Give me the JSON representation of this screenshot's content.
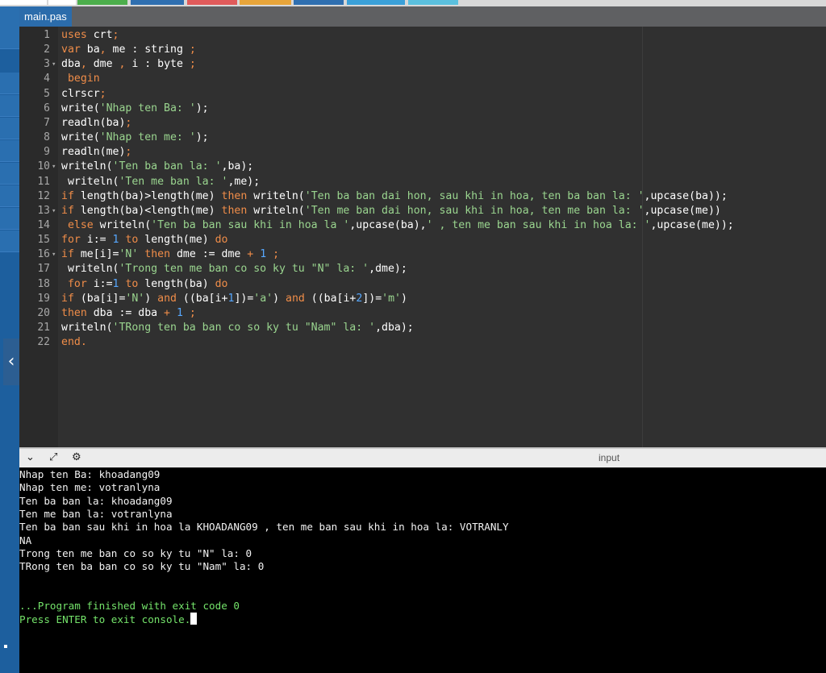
{
  "toolbar": {
    "colors": [
      "#ffffff",
      "#ffffff",
      "#4cae4c",
      "#2f6fb0",
      "#e05b5b",
      "#e8a53a",
      "#2f6fb0",
      "#3aa0d8",
      "#5bc0de"
    ]
  },
  "editor": {
    "tab_label": "main.pas",
    "lines": [
      {
        "n": "1",
        "fold": "",
        "tokens": [
          {
            "t": "uses",
            "c": "kw"
          },
          {
            "t": " crt",
            "c": ""
          },
          {
            "t": ";",
            "c": "kw"
          }
        ]
      },
      {
        "n": "2",
        "fold": "",
        "tokens": [
          {
            "t": "var",
            "c": "kw"
          },
          {
            "t": " ba",
            "c": ""
          },
          {
            "t": ",",
            "c": "kw"
          },
          {
            "t": " me : string ",
            "c": ""
          },
          {
            "t": ";",
            "c": "kw"
          }
        ]
      },
      {
        "n": "3",
        "fold": "▾",
        "tokens": [
          {
            "t": "dba",
            "c": ""
          },
          {
            "t": ",",
            "c": "kw"
          },
          {
            "t": " dme ",
            "c": ""
          },
          {
            "t": ",",
            "c": "kw"
          },
          {
            "t": " i : byte ",
            "c": ""
          },
          {
            "t": ";",
            "c": "kw"
          }
        ]
      },
      {
        "n": "4",
        "fold": "",
        "tokens": [
          {
            "t": " begin",
            "c": "kw"
          }
        ]
      },
      {
        "n": "5",
        "fold": "",
        "tokens": [
          {
            "t": "clrscr",
            "c": ""
          },
          {
            "t": ";",
            "c": "kw"
          }
        ]
      },
      {
        "n": "6",
        "fold": "",
        "tokens": [
          {
            "t": "write(",
            "c": ""
          },
          {
            "t": "'Nhap ten Ba: '",
            "c": "str"
          },
          {
            "t": ");",
            "c": ""
          }
        ]
      },
      {
        "n": "7",
        "fold": "",
        "tokens": [
          {
            "t": "readln(ba)",
            "c": ""
          },
          {
            "t": ";",
            "c": "kw"
          }
        ]
      },
      {
        "n": "8",
        "fold": "",
        "tokens": [
          {
            "t": "write(",
            "c": ""
          },
          {
            "t": "'Nhap ten me: '",
            "c": "str"
          },
          {
            "t": ");",
            "c": ""
          }
        ]
      },
      {
        "n": "9",
        "fold": "",
        "tokens": [
          {
            "t": "readln(me)",
            "c": ""
          },
          {
            "t": ";",
            "c": "kw"
          }
        ]
      },
      {
        "n": "10",
        "fold": "▾",
        "tokens": [
          {
            "t": "writeln(",
            "c": ""
          },
          {
            "t": "'Ten ba ban la: '",
            "c": "str"
          },
          {
            "t": ",ba);",
            "c": ""
          }
        ]
      },
      {
        "n": "11",
        "fold": "",
        "tokens": [
          {
            "t": " writeln(",
            "c": ""
          },
          {
            "t": "'Ten me ban la: '",
            "c": "str"
          },
          {
            "t": ",me);",
            "c": ""
          }
        ]
      },
      {
        "n": "12",
        "fold": "",
        "tokens": [
          {
            "t": "if",
            "c": "kw"
          },
          {
            "t": " length(ba)>length(me) ",
            "c": ""
          },
          {
            "t": "then",
            "c": "kw"
          },
          {
            "t": " writeln(",
            "c": ""
          },
          {
            "t": "'Ten ba ban dai hon, sau khi in hoa, ten ba ban la: '",
            "c": "str"
          },
          {
            "t": ",upcase(ba));",
            "c": ""
          }
        ]
      },
      {
        "n": "13",
        "fold": "▾",
        "tokens": [
          {
            "t": "if",
            "c": "kw"
          },
          {
            "t": " length(ba)<length(me) ",
            "c": ""
          },
          {
            "t": "then",
            "c": "kw"
          },
          {
            "t": " writeln(",
            "c": ""
          },
          {
            "t": "'Ten me ban dai hon, sau khi in hoa, ten me ban la: '",
            "c": "str"
          },
          {
            "t": ",upcase(me))",
            "c": ""
          }
        ]
      },
      {
        "n": "14",
        "fold": "",
        "tokens": [
          {
            "t": " else",
            "c": "kw"
          },
          {
            "t": " writeln(",
            "c": ""
          },
          {
            "t": "'Ten ba ban sau khi in hoa la '",
            "c": "str"
          },
          {
            "t": ",upcase(ba),",
            "c": ""
          },
          {
            "t": "' , ten me ban sau khi in hoa la: '",
            "c": "str"
          },
          {
            "t": ",upcase(me));",
            "c": ""
          }
        ]
      },
      {
        "n": "15",
        "fold": "",
        "tokens": [
          {
            "t": "for",
            "c": "kw"
          },
          {
            "t": " i:= ",
            "c": ""
          },
          {
            "t": "1",
            "c": "num"
          },
          {
            "t": " ",
            "c": ""
          },
          {
            "t": "to",
            "c": "kw"
          },
          {
            "t": " length(me) ",
            "c": ""
          },
          {
            "t": "do",
            "c": "kw"
          }
        ]
      },
      {
        "n": "16",
        "fold": "▾",
        "tokens": [
          {
            "t": "if",
            "c": "kw"
          },
          {
            "t": " me[i]=",
            "c": ""
          },
          {
            "t": "'N'",
            "c": "str"
          },
          {
            "t": " ",
            "c": ""
          },
          {
            "t": "then",
            "c": "kw"
          },
          {
            "t": " dme := dme ",
            "c": ""
          },
          {
            "t": "+",
            "c": "kw"
          },
          {
            "t": " ",
            "c": ""
          },
          {
            "t": "1",
            "c": "num"
          },
          {
            "t": " ",
            "c": ""
          },
          {
            "t": ";",
            "c": "kw"
          }
        ]
      },
      {
        "n": "17",
        "fold": "",
        "tokens": [
          {
            "t": " writeln(",
            "c": ""
          },
          {
            "t": "'Trong ten me ban co so ky tu \"N\" la: '",
            "c": "str"
          },
          {
            "t": ",dme);",
            "c": ""
          }
        ]
      },
      {
        "n": "18",
        "fold": "",
        "tokens": [
          {
            "t": " for",
            "c": "kw"
          },
          {
            "t": " i:=",
            "c": ""
          },
          {
            "t": "1",
            "c": "num"
          },
          {
            "t": " ",
            "c": ""
          },
          {
            "t": "to",
            "c": "kw"
          },
          {
            "t": " length(ba) ",
            "c": ""
          },
          {
            "t": "do",
            "c": "kw"
          }
        ]
      },
      {
        "n": "19",
        "fold": "",
        "tokens": [
          {
            "t": "if",
            "c": "kw"
          },
          {
            "t": " (ba[i]=",
            "c": ""
          },
          {
            "t": "'N'",
            "c": "str"
          },
          {
            "t": ") ",
            "c": ""
          },
          {
            "t": "and",
            "c": "kw"
          },
          {
            "t": " ((ba[i+",
            "c": ""
          },
          {
            "t": "1",
            "c": "num"
          },
          {
            "t": "])=",
            "c": ""
          },
          {
            "t": "'a'",
            "c": "str"
          },
          {
            "t": ") ",
            "c": ""
          },
          {
            "t": "and",
            "c": "kw"
          },
          {
            "t": " ((ba[i+",
            "c": ""
          },
          {
            "t": "2",
            "c": "num"
          },
          {
            "t": "])=",
            "c": ""
          },
          {
            "t": "'m'",
            "c": "str"
          },
          {
            "t": ")",
            "c": ""
          }
        ]
      },
      {
        "n": "20",
        "fold": "",
        "tokens": [
          {
            "t": "then",
            "c": "kw"
          },
          {
            "t": " dba := dba ",
            "c": ""
          },
          {
            "t": "+",
            "c": "kw"
          },
          {
            "t": " ",
            "c": ""
          },
          {
            "t": "1",
            "c": "num"
          },
          {
            "t": " ",
            "c": ""
          },
          {
            "t": ";",
            "c": "kw"
          }
        ]
      },
      {
        "n": "21",
        "fold": "",
        "tokens": [
          {
            "t": "writeln(",
            "c": ""
          },
          {
            "t": "'TRong ten ba ban co so ky tu \"Nam\" la: '",
            "c": "str"
          },
          {
            "t": ",dba);",
            "c": ""
          }
        ]
      },
      {
        "n": "22",
        "fold": "",
        "tokens": [
          {
            "t": "end.",
            "c": "kw"
          }
        ]
      }
    ]
  },
  "output_toolbar": {
    "collapse_icon": "⌄",
    "expand_icon": "⤢",
    "settings_icon": "⚙",
    "input_label": "input"
  },
  "console": {
    "lines": [
      {
        "text": "Nhap ten Ba: khoadang09",
        "green": false
      },
      {
        "text": "Nhap ten me: votranlyna",
        "green": false
      },
      {
        "text": "Ten ba ban la: khoadang09",
        "green": false
      },
      {
        "text": "Ten me ban la: votranlyna",
        "green": false
      },
      {
        "text": "Ten ba ban sau khi in hoa la KHOADANG09 , ten me ban sau khi in hoa la: VOTRANLY",
        "green": false
      },
      {
        "text": "NA",
        "green": false
      },
      {
        "text": "Trong ten me ban co so ky tu \"N\" la: 0",
        "green": false
      },
      {
        "text": "TRong ten ba ban co so ky tu \"Nam\" la: 0",
        "green": false
      },
      {
        "text": "",
        "green": false
      },
      {
        "text": "",
        "green": false
      },
      {
        "text": "...Program finished with exit code 0",
        "green": true
      },
      {
        "text": "Press ENTER to exit console.",
        "green": true
      }
    ]
  },
  "sidebar": {
    "collapse_icon": "‹"
  }
}
